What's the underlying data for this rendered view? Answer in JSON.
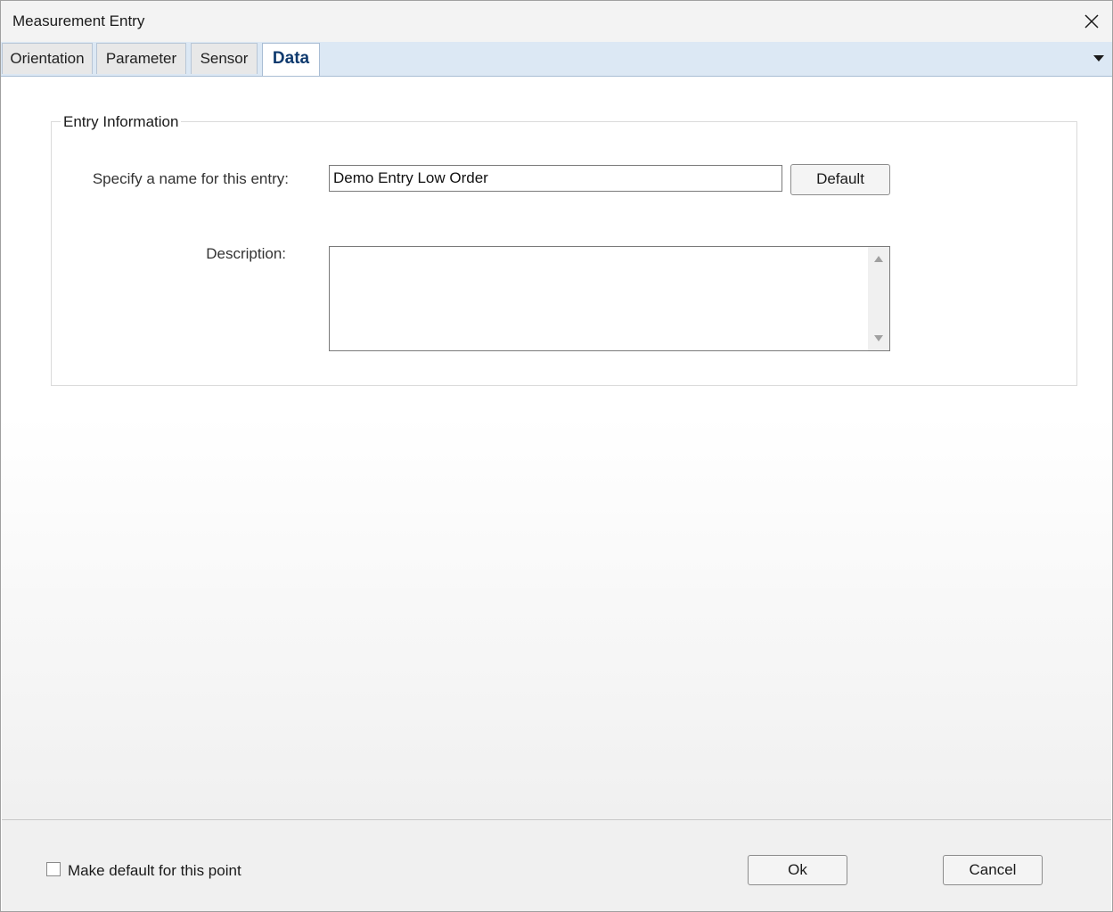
{
  "window": {
    "title": "Measurement Entry"
  },
  "tabs": [
    {
      "label": "Orientation",
      "active": false
    },
    {
      "label": "Parameter",
      "active": false
    },
    {
      "label": "Sensor",
      "active": false
    },
    {
      "label": "Data",
      "active": true
    }
  ],
  "entry_info": {
    "group_title": "Entry Information",
    "name_label": "Specify a name for this entry:",
    "name_value": "Demo Entry Low Order",
    "default_button": "Default",
    "description_label": "Description:",
    "description_value": ""
  },
  "footer": {
    "make_default_label": "Make default for this point",
    "make_default_checked": false,
    "ok_button": "Ok",
    "cancel_button": "Cancel"
  },
  "colors": {
    "tab_strip": "#dce8f4",
    "active_tab_text": "#0f3a6e"
  }
}
